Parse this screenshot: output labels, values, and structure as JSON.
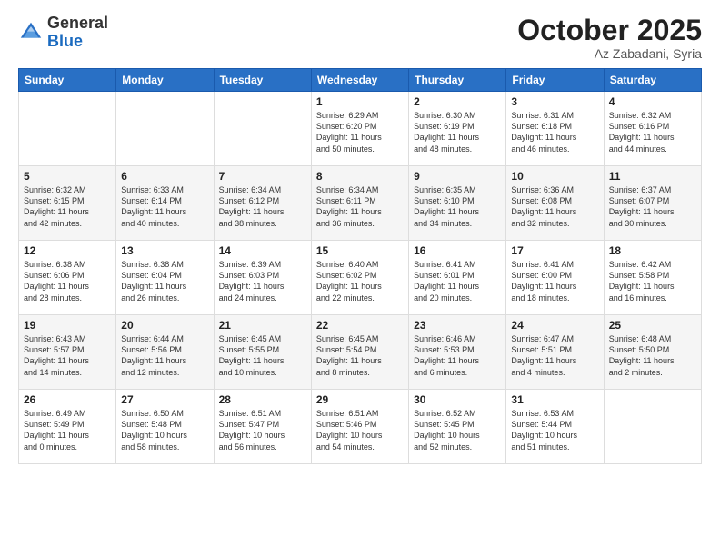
{
  "header": {
    "logo": {
      "general": "General",
      "blue": "Blue"
    },
    "title": "October 2025",
    "location": "Az Zabadani, Syria"
  },
  "weekdays": [
    "Sunday",
    "Monday",
    "Tuesday",
    "Wednesday",
    "Thursday",
    "Friday",
    "Saturday"
  ],
  "weeks": [
    [
      {
        "day": "",
        "info": ""
      },
      {
        "day": "",
        "info": ""
      },
      {
        "day": "",
        "info": ""
      },
      {
        "day": "1",
        "info": "Sunrise: 6:29 AM\nSunset: 6:20 PM\nDaylight: 11 hours\nand 50 minutes."
      },
      {
        "day": "2",
        "info": "Sunrise: 6:30 AM\nSunset: 6:19 PM\nDaylight: 11 hours\nand 48 minutes."
      },
      {
        "day": "3",
        "info": "Sunrise: 6:31 AM\nSunset: 6:18 PM\nDaylight: 11 hours\nand 46 minutes."
      },
      {
        "day": "4",
        "info": "Sunrise: 6:32 AM\nSunset: 6:16 PM\nDaylight: 11 hours\nand 44 minutes."
      }
    ],
    [
      {
        "day": "5",
        "info": "Sunrise: 6:32 AM\nSunset: 6:15 PM\nDaylight: 11 hours\nand 42 minutes."
      },
      {
        "day": "6",
        "info": "Sunrise: 6:33 AM\nSunset: 6:14 PM\nDaylight: 11 hours\nand 40 minutes."
      },
      {
        "day": "7",
        "info": "Sunrise: 6:34 AM\nSunset: 6:12 PM\nDaylight: 11 hours\nand 38 minutes."
      },
      {
        "day": "8",
        "info": "Sunrise: 6:34 AM\nSunset: 6:11 PM\nDaylight: 11 hours\nand 36 minutes."
      },
      {
        "day": "9",
        "info": "Sunrise: 6:35 AM\nSunset: 6:10 PM\nDaylight: 11 hours\nand 34 minutes."
      },
      {
        "day": "10",
        "info": "Sunrise: 6:36 AM\nSunset: 6:08 PM\nDaylight: 11 hours\nand 32 minutes."
      },
      {
        "day": "11",
        "info": "Sunrise: 6:37 AM\nSunset: 6:07 PM\nDaylight: 11 hours\nand 30 minutes."
      }
    ],
    [
      {
        "day": "12",
        "info": "Sunrise: 6:38 AM\nSunset: 6:06 PM\nDaylight: 11 hours\nand 28 minutes."
      },
      {
        "day": "13",
        "info": "Sunrise: 6:38 AM\nSunset: 6:04 PM\nDaylight: 11 hours\nand 26 minutes."
      },
      {
        "day": "14",
        "info": "Sunrise: 6:39 AM\nSunset: 6:03 PM\nDaylight: 11 hours\nand 24 minutes."
      },
      {
        "day": "15",
        "info": "Sunrise: 6:40 AM\nSunset: 6:02 PM\nDaylight: 11 hours\nand 22 minutes."
      },
      {
        "day": "16",
        "info": "Sunrise: 6:41 AM\nSunset: 6:01 PM\nDaylight: 11 hours\nand 20 minutes."
      },
      {
        "day": "17",
        "info": "Sunrise: 6:41 AM\nSunset: 6:00 PM\nDaylight: 11 hours\nand 18 minutes."
      },
      {
        "day": "18",
        "info": "Sunrise: 6:42 AM\nSunset: 5:58 PM\nDaylight: 11 hours\nand 16 minutes."
      }
    ],
    [
      {
        "day": "19",
        "info": "Sunrise: 6:43 AM\nSunset: 5:57 PM\nDaylight: 11 hours\nand 14 minutes."
      },
      {
        "day": "20",
        "info": "Sunrise: 6:44 AM\nSunset: 5:56 PM\nDaylight: 11 hours\nand 12 minutes."
      },
      {
        "day": "21",
        "info": "Sunrise: 6:45 AM\nSunset: 5:55 PM\nDaylight: 11 hours\nand 10 minutes."
      },
      {
        "day": "22",
        "info": "Sunrise: 6:45 AM\nSunset: 5:54 PM\nDaylight: 11 hours\nand 8 minutes."
      },
      {
        "day": "23",
        "info": "Sunrise: 6:46 AM\nSunset: 5:53 PM\nDaylight: 11 hours\nand 6 minutes."
      },
      {
        "day": "24",
        "info": "Sunrise: 6:47 AM\nSunset: 5:51 PM\nDaylight: 11 hours\nand 4 minutes."
      },
      {
        "day": "25",
        "info": "Sunrise: 6:48 AM\nSunset: 5:50 PM\nDaylight: 11 hours\nand 2 minutes."
      }
    ],
    [
      {
        "day": "26",
        "info": "Sunrise: 6:49 AM\nSunset: 5:49 PM\nDaylight: 11 hours\nand 0 minutes."
      },
      {
        "day": "27",
        "info": "Sunrise: 6:50 AM\nSunset: 5:48 PM\nDaylight: 10 hours\nand 58 minutes."
      },
      {
        "day": "28",
        "info": "Sunrise: 6:51 AM\nSunset: 5:47 PM\nDaylight: 10 hours\nand 56 minutes."
      },
      {
        "day": "29",
        "info": "Sunrise: 6:51 AM\nSunset: 5:46 PM\nDaylight: 10 hours\nand 54 minutes."
      },
      {
        "day": "30",
        "info": "Sunrise: 6:52 AM\nSunset: 5:45 PM\nDaylight: 10 hours\nand 52 minutes."
      },
      {
        "day": "31",
        "info": "Sunrise: 6:53 AM\nSunset: 5:44 PM\nDaylight: 10 hours\nand 51 minutes."
      },
      {
        "day": "",
        "info": ""
      }
    ]
  ]
}
